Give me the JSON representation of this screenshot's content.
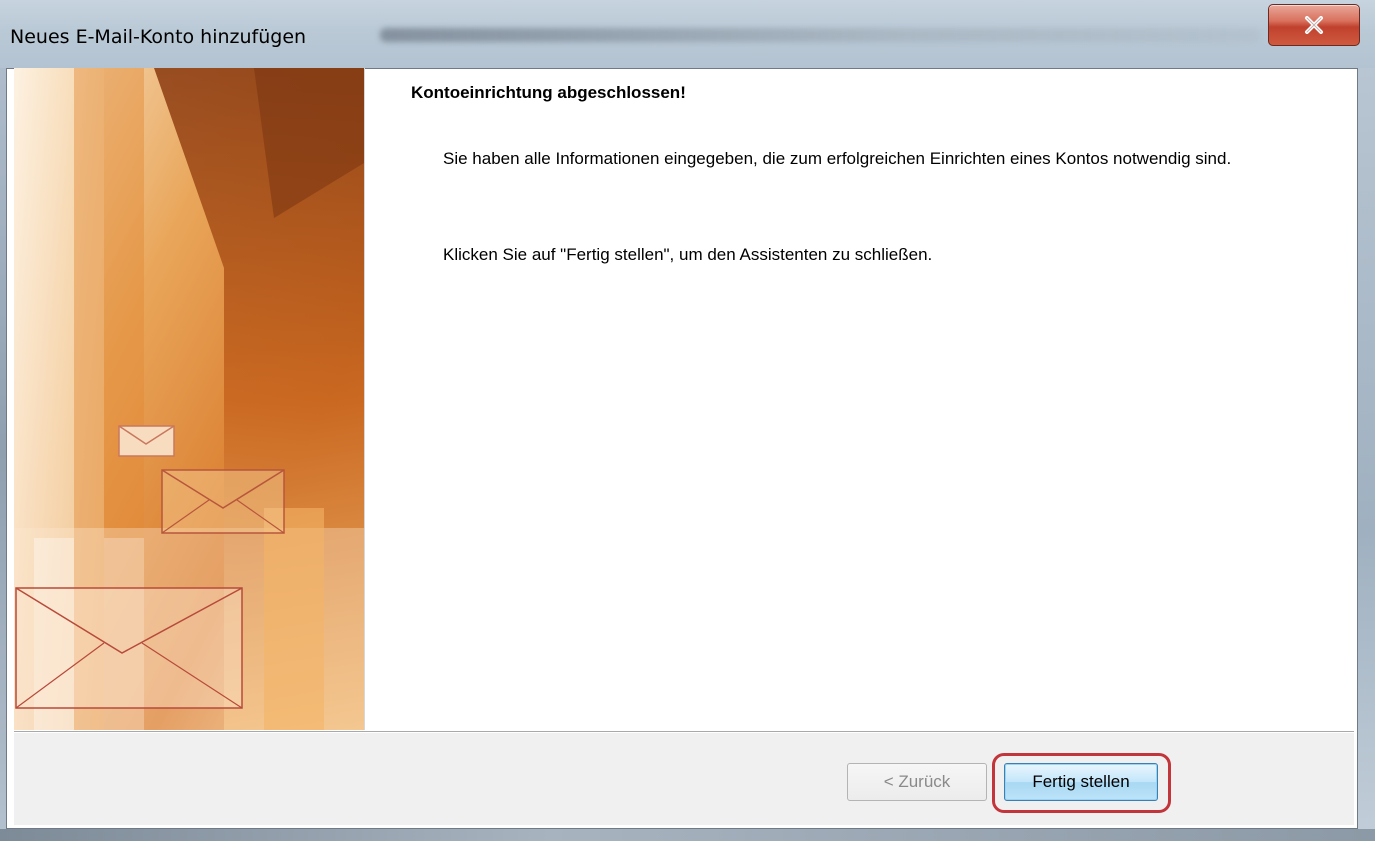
{
  "window": {
    "title": "Neues E-Mail-Konto hinzufügen",
    "close_icon": "close-icon"
  },
  "main": {
    "heading": "Kontoeinrichtung abgeschlossen!",
    "paragraph1": "Sie haben alle Informationen eingegeben, die zum erfolgreichen Einrichten eines Kontos notwendig sind.",
    "paragraph2": "Klicken Sie auf \"Fertig stellen\", um den Assistenten zu schließen."
  },
  "buttons": {
    "back_label": "< Zurück",
    "finish_label": "Fertig stellen"
  },
  "colors": {
    "highlight_ring": "#c2353a",
    "banner_orange": "#e8902f",
    "finish_button": "#bde3f8"
  },
  "banner": {
    "icons": [
      "envelope-icon",
      "envelope-icon",
      "envelope-icon"
    ]
  }
}
